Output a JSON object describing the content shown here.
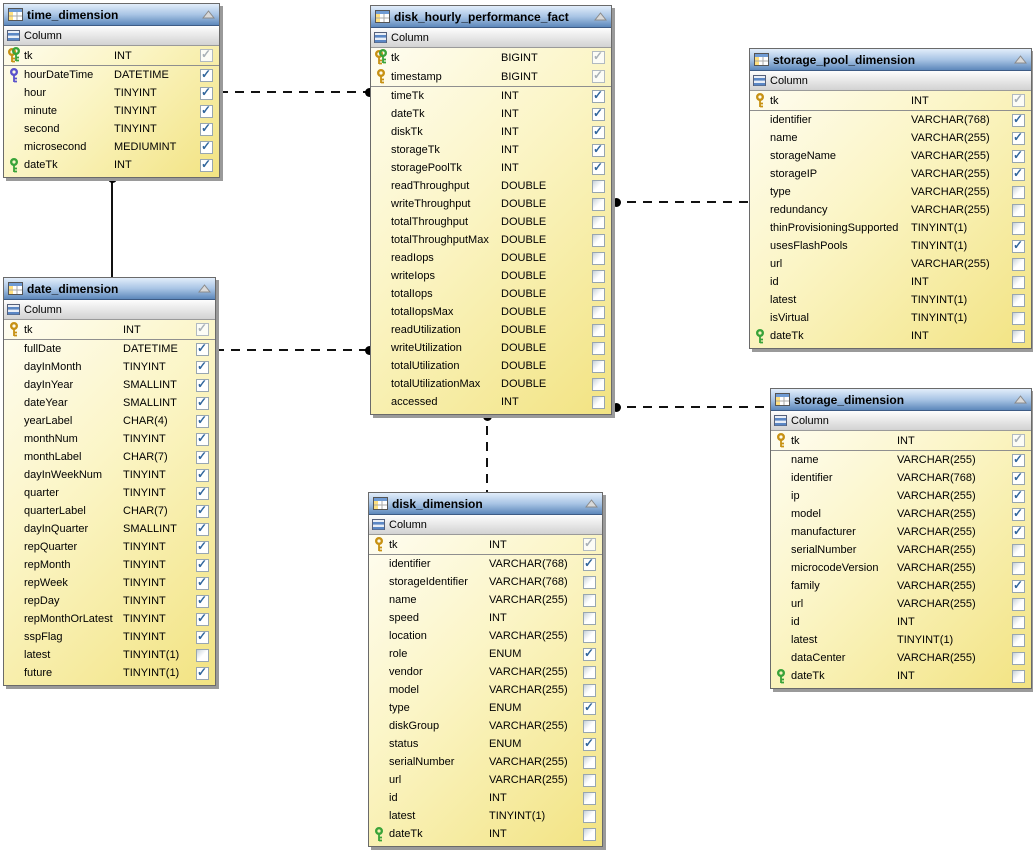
{
  "diagram": {
    "colors": {
      "header_blue": "#5d88bb",
      "body_yellow": "#f2e382",
      "check_blue": "#31669c",
      "pk_gold": "#c79114",
      "fk_green": "#39a339",
      "fk_blue": "#5a52cc",
      "connector_black": "#111111"
    },
    "tables": [
      {
        "id": "time_dimension",
        "title": "time_dimension",
        "column_header": "Column",
        "columns": [
          {
            "name": "tk",
            "type": "INT",
            "key": "pk2",
            "state": "disabled",
            "key_row": true
          },
          {
            "name": "hourDateTime",
            "type": "DATETIME",
            "key": "blue",
            "state": "checked"
          },
          {
            "name": "hour",
            "type": "TINYINT",
            "key": null,
            "state": "checked"
          },
          {
            "name": "minute",
            "type": "TINYINT",
            "key": null,
            "state": "checked"
          },
          {
            "name": "second",
            "type": "TINYINT",
            "key": null,
            "state": "checked"
          },
          {
            "name": "microsecond",
            "type": "MEDIUMINT",
            "key": null,
            "state": "checked"
          },
          {
            "name": "dateTk",
            "type": "INT",
            "key": "green",
            "state": "checked"
          }
        ]
      },
      {
        "id": "date_dimension",
        "title": "date_dimension",
        "column_header": "Column",
        "columns": [
          {
            "name": "tk",
            "type": "INT",
            "key": "pk",
            "state": "disabled",
            "key_row": true
          },
          {
            "name": "fullDate",
            "type": "DATETIME",
            "key": null,
            "state": "checked"
          },
          {
            "name": "dayInMonth",
            "type": "TINYINT",
            "key": null,
            "state": "checked"
          },
          {
            "name": "dayInYear",
            "type": "SMALLINT",
            "key": null,
            "state": "checked"
          },
          {
            "name": "dateYear",
            "type": "SMALLINT",
            "key": null,
            "state": "checked"
          },
          {
            "name": "yearLabel",
            "type": "CHAR(4)",
            "key": null,
            "state": "checked"
          },
          {
            "name": "monthNum",
            "type": "TINYINT",
            "key": null,
            "state": "checked"
          },
          {
            "name": "monthLabel",
            "type": "CHAR(7)",
            "key": null,
            "state": "checked"
          },
          {
            "name": "dayInWeekNum",
            "type": "TINYINT",
            "key": null,
            "state": "checked"
          },
          {
            "name": "quarter",
            "type": "TINYINT",
            "key": null,
            "state": "checked"
          },
          {
            "name": "quarterLabel",
            "type": "CHAR(7)",
            "key": null,
            "state": "checked"
          },
          {
            "name": "dayInQuarter",
            "type": "SMALLINT",
            "key": null,
            "state": "checked"
          },
          {
            "name": "repQuarter",
            "type": "TINYINT",
            "key": null,
            "state": "checked"
          },
          {
            "name": "repMonth",
            "type": "TINYINT",
            "key": null,
            "state": "checked"
          },
          {
            "name": "repWeek",
            "type": "TINYINT",
            "key": null,
            "state": "checked"
          },
          {
            "name": "repDay",
            "type": "TINYINT",
            "key": null,
            "state": "checked"
          },
          {
            "name": "repMonthOrLatest",
            "type": "TINYINT",
            "key": null,
            "state": "checked"
          },
          {
            "name": "sspFlag",
            "type": "TINYINT",
            "key": null,
            "state": "checked"
          },
          {
            "name": "latest",
            "type": "TINYINT(1)",
            "key": null,
            "state": "unchecked"
          },
          {
            "name": "future",
            "type": "TINYINT(1)",
            "key": null,
            "state": "checked"
          }
        ]
      },
      {
        "id": "disk_hourly_performance_fact",
        "title": "disk_hourly_performance_fact",
        "column_header": "Column",
        "columns": [
          {
            "name": "tk",
            "type": "BIGINT",
            "key": "pk2",
            "state": "disabled",
            "key_row": true
          },
          {
            "name": "timestamp",
            "type": "BIGINT",
            "key": "pk",
            "state": "disabled",
            "key_row": true
          },
          {
            "name": "timeTk",
            "type": "INT",
            "key": null,
            "state": "checked"
          },
          {
            "name": "dateTk",
            "type": "INT",
            "key": null,
            "state": "checked"
          },
          {
            "name": "diskTk",
            "type": "INT",
            "key": null,
            "state": "checked"
          },
          {
            "name": "storageTk",
            "type": "INT",
            "key": null,
            "state": "checked"
          },
          {
            "name": "storagePoolTk",
            "type": "INT",
            "key": null,
            "state": "checked"
          },
          {
            "name": "readThroughput",
            "type": "DOUBLE",
            "key": null,
            "state": "unchecked"
          },
          {
            "name": "writeThroughput",
            "type": "DOUBLE",
            "key": null,
            "state": "unchecked"
          },
          {
            "name": "totalThroughput",
            "type": "DOUBLE",
            "key": null,
            "state": "unchecked"
          },
          {
            "name": "totalThroughputMax",
            "type": "DOUBLE",
            "key": null,
            "state": "unchecked"
          },
          {
            "name": "readIops",
            "type": "DOUBLE",
            "key": null,
            "state": "unchecked"
          },
          {
            "name": "writeIops",
            "type": "DOUBLE",
            "key": null,
            "state": "unchecked"
          },
          {
            "name": "totalIops",
            "type": "DOUBLE",
            "key": null,
            "state": "unchecked"
          },
          {
            "name": "totalIopsMax",
            "type": "DOUBLE",
            "key": null,
            "state": "unchecked"
          },
          {
            "name": "readUtilization",
            "type": "DOUBLE",
            "key": null,
            "state": "unchecked"
          },
          {
            "name": "writeUtilization",
            "type": "DOUBLE",
            "key": null,
            "state": "unchecked"
          },
          {
            "name": "totalUtilization",
            "type": "DOUBLE",
            "key": null,
            "state": "unchecked"
          },
          {
            "name": "totalUtilizationMax",
            "type": "DOUBLE",
            "key": null,
            "state": "unchecked"
          },
          {
            "name": "accessed",
            "type": "INT",
            "key": null,
            "state": "unchecked"
          }
        ]
      },
      {
        "id": "storage_pool_dimension",
        "title": "storage_pool_dimension",
        "column_header": "Column",
        "columns": [
          {
            "name": "tk",
            "type": "INT",
            "key": "pk",
            "state": "disabled",
            "key_row": true
          },
          {
            "name": "identifier",
            "type": "VARCHAR(768)",
            "key": null,
            "state": "checked"
          },
          {
            "name": "name",
            "type": "VARCHAR(255)",
            "key": null,
            "state": "checked"
          },
          {
            "name": "storageName",
            "type": "VARCHAR(255)",
            "key": null,
            "state": "checked"
          },
          {
            "name": "storageIP",
            "type": "VARCHAR(255)",
            "key": null,
            "state": "checked"
          },
          {
            "name": "type",
            "type": "VARCHAR(255)",
            "key": null,
            "state": "unchecked"
          },
          {
            "name": "redundancy",
            "type": "VARCHAR(255)",
            "key": null,
            "state": "unchecked"
          },
          {
            "name": "thinProvisioningSupported",
            "type": "TINYINT(1)",
            "key": null,
            "state": "unchecked"
          },
          {
            "name": "usesFlashPools",
            "type": "TINYINT(1)",
            "key": null,
            "state": "checked"
          },
          {
            "name": "url",
            "type": "VARCHAR(255)",
            "key": null,
            "state": "unchecked"
          },
          {
            "name": "id",
            "type": "INT",
            "key": null,
            "state": "unchecked"
          },
          {
            "name": "latest",
            "type": "TINYINT(1)",
            "key": null,
            "state": "unchecked"
          },
          {
            "name": "isVirtual",
            "type": "TINYINT(1)",
            "key": null,
            "state": "unchecked"
          },
          {
            "name": "dateTk",
            "type": "INT",
            "key": "green",
            "state": "unchecked"
          }
        ]
      },
      {
        "id": "storage_dimension",
        "title": "storage_dimension",
        "column_header": "Column",
        "columns": [
          {
            "name": "tk",
            "type": "INT",
            "key": "pk",
            "state": "disabled",
            "key_row": true
          },
          {
            "name": "name",
            "type": "VARCHAR(255)",
            "key": null,
            "state": "checked"
          },
          {
            "name": "identifier",
            "type": "VARCHAR(768)",
            "key": null,
            "state": "checked"
          },
          {
            "name": "ip",
            "type": "VARCHAR(255)",
            "key": null,
            "state": "checked"
          },
          {
            "name": "model",
            "type": "VARCHAR(255)",
            "key": null,
            "state": "checked"
          },
          {
            "name": "manufacturer",
            "type": "VARCHAR(255)",
            "key": null,
            "state": "checked"
          },
          {
            "name": "serialNumber",
            "type": "VARCHAR(255)",
            "key": null,
            "state": "unchecked"
          },
          {
            "name": "microcodeVersion",
            "type": "VARCHAR(255)",
            "key": null,
            "state": "unchecked"
          },
          {
            "name": "family",
            "type": "VARCHAR(255)",
            "key": null,
            "state": "checked"
          },
          {
            "name": "url",
            "type": "VARCHAR(255)",
            "key": null,
            "state": "unchecked"
          },
          {
            "name": "id",
            "type": "INT",
            "key": null,
            "state": "unchecked"
          },
          {
            "name": "latest",
            "type": "TINYINT(1)",
            "key": null,
            "state": "unchecked"
          },
          {
            "name": "dataCenter",
            "type": "VARCHAR(255)",
            "key": null,
            "state": "unchecked"
          },
          {
            "name": "dateTk",
            "type": "INT",
            "key": "green",
            "state": "unchecked"
          }
        ]
      },
      {
        "id": "disk_dimension",
        "title": "disk_dimension",
        "column_header": "Column",
        "columns": [
          {
            "name": "tk",
            "type": "INT",
            "key": "pk",
            "state": "disabled",
            "key_row": true
          },
          {
            "name": "identifier",
            "type": "VARCHAR(768)",
            "key": null,
            "state": "checked"
          },
          {
            "name": "storageIdentifier",
            "type": "VARCHAR(768)",
            "key": null,
            "state": "unchecked"
          },
          {
            "name": "name",
            "type": "VARCHAR(255)",
            "key": null,
            "state": "unchecked"
          },
          {
            "name": "speed",
            "type": "INT",
            "key": null,
            "state": "unchecked"
          },
          {
            "name": "location",
            "type": "VARCHAR(255)",
            "key": null,
            "state": "unchecked"
          },
          {
            "name": "role",
            "type": "ENUM",
            "key": null,
            "state": "checked"
          },
          {
            "name": "vendor",
            "type": "VARCHAR(255)",
            "key": null,
            "state": "unchecked"
          },
          {
            "name": "model",
            "type": "VARCHAR(255)",
            "key": null,
            "state": "unchecked"
          },
          {
            "name": "type",
            "type": "ENUM",
            "key": null,
            "state": "checked"
          },
          {
            "name": "diskGroup",
            "type": "VARCHAR(255)",
            "key": null,
            "state": "unchecked"
          },
          {
            "name": "status",
            "type": "ENUM",
            "key": null,
            "state": "checked"
          },
          {
            "name": "serialNumber",
            "type": "VARCHAR(255)",
            "key": null,
            "state": "unchecked"
          },
          {
            "name": "url",
            "type": "VARCHAR(255)",
            "key": null,
            "state": "unchecked"
          },
          {
            "name": "id",
            "type": "INT",
            "key": null,
            "state": "unchecked"
          },
          {
            "name": "latest",
            "type": "TINYINT(1)",
            "key": null,
            "state": "unchecked"
          },
          {
            "name": "dateTk",
            "type": "INT",
            "key": "green",
            "state": "unchecked"
          }
        ]
      }
    ],
    "connectors": [
      {
        "from": "time_dimension",
        "to": "disk_hourly_performance_fact",
        "style": "dashed"
      },
      {
        "from": "date_dimension",
        "to": "disk_hourly_performance_fact",
        "style": "dashed"
      },
      {
        "from": "disk_hourly_performance_fact",
        "to": "storage_pool_dimension",
        "style": "dashed"
      },
      {
        "from": "disk_hourly_performance_fact",
        "to": "storage_dimension",
        "style": "dashed"
      },
      {
        "from": "disk_hourly_performance_fact",
        "to": "disk_dimension",
        "style": "dashed"
      },
      {
        "from": "time_dimension",
        "to": "date_dimension",
        "style": "solid"
      }
    ]
  }
}
